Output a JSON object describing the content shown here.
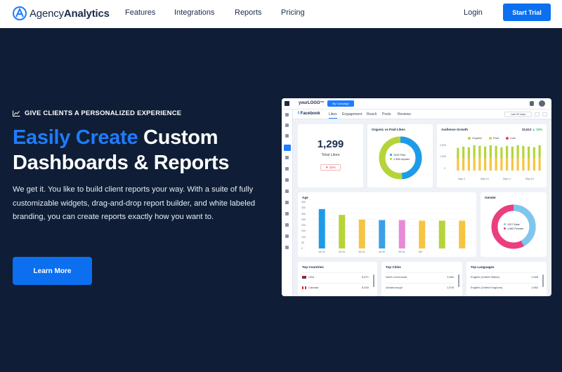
{
  "nav": {
    "brand_light": "Agency",
    "brand_bold": "Analytics",
    "links": [
      "Features",
      "Integrations",
      "Reports",
      "Pricing"
    ],
    "login": "Login",
    "cta": "Start Trial"
  },
  "hero": {
    "eyebrow": "GIVE CLIENTS A PERSONALIZED EXPERIENCE",
    "title_accent": "Easily Create",
    "title_rest_1": "Custom",
    "title_rest_2": "Dashboards & Reports",
    "lead": "We get it. You like to build client reports your way. With a suite of fully customizable widgets, drag-and-drop report builder, and white labeled branding, you can create reports exactly how you want to.",
    "button": "Learn More"
  },
  "colors": {
    "accent": "#1e7cff",
    "button": "#0b6ff0",
    "background": "#0f1e36",
    "paid": "#1e9be8",
    "unpaid": "#b5d43a",
    "organic": "#b5d43a",
    "lost": "#f5c542",
    "male": "#7cc7ef",
    "female": "#ec3d7f"
  },
  "dashboard": {
    "logo": "yourLOGO™",
    "campaign": "My Campaign",
    "date_range": "Last 30 days",
    "platform": "Facebook",
    "tabs": [
      "Likes",
      "Engagement",
      "Reach",
      "Posts",
      "Reviews"
    ],
    "total_likes": {
      "value": "1,299",
      "label": "Total Likes",
      "change": "35%"
    },
    "organic_paid": {
      "title": "Organic vs Paid Likes",
      "paid_label": "1232 Paid",
      "unpaid_label": "1,308 Unpaid",
      "paid": 1232,
      "unpaid": 1308
    },
    "audience": {
      "title": "Audience Growth",
      "total": "22,612",
      "change": "10%",
      "legend": [
        "Organic",
        "Paid",
        "Lost"
      ],
      "xlabels": [
        "May 3",
        "May 10",
        "May 17",
        "May 24"
      ],
      "yticks": [
        "2,000",
        "1,000",
        "0"
      ]
    },
    "age": {
      "title": "Age",
      "yticks": [
        "400",
        "350",
        "300",
        "250",
        "200",
        "150",
        "100",
        "50",
        "0"
      ],
      "categories": [
        "18-24",
        "25-34",
        "35-44",
        "45-54",
        "55-64",
        "65+",
        "",
        ""
      ]
    },
    "gender": {
      "title": "Gender",
      "male_label": "1207 Male",
      "female_label": "1,660 Female",
      "male": 1207,
      "female": 1660
    },
    "countries": {
      "title": "Top Countries",
      "rows": [
        {
          "name": "USA",
          "value": "5,671"
        },
        {
          "name": "Canada",
          "value": "5,540"
        }
      ]
    },
    "cities": {
      "title": "Top Cities",
      "rows": [
        {
          "name": "North Lexxmouth",
          "value": "1,584"
        },
        {
          "name": "Ashaborough",
          "value": "1,578"
        }
      ]
    },
    "languages": {
      "title": "Top Languages",
      "rows": [
        {
          "name": "English (United States)",
          "value": "1,548"
        },
        {
          "name": "English (United Kingdom)",
          "value": "1,582"
        }
      ]
    }
  },
  "chart_data": [
    {
      "type": "bar",
      "title": "Age",
      "categories": [
        "18-24",
        "25-34",
        "35-44",
        "45-54",
        "55-64",
        "65+",
        "",
        ""
      ],
      "values": [
        340,
        290,
        250,
        245,
        245,
        240,
        240,
        240
      ],
      "ylim": [
        0,
        400
      ],
      "colors": [
        "#1e9be8",
        "#b5d43a",
        "#f5c542",
        "#3aa0e8",
        "#e88ad8",
        "#f5c542",
        "#b5d43a",
        "#f5c542"
      ]
    },
    {
      "type": "bar",
      "title": "Audience Growth",
      "series": [
        {
          "name": "Organic",
          "values": [
            1700,
            1800,
            1750,
            1900,
            1850,
            1800,
            1900,
            1850,
            1750,
            1850,
            1800,
            1900,
            1850,
            1800,
            1750,
            1900
          ]
        },
        {
          "name": "Lost",
          "values": [
            900,
            950,
            900,
            1000,
            950,
            900,
            1000,
            950,
            900,
            950,
            900,
            1000,
            950,
            900,
            950,
            1000
          ]
        }
      ],
      "ylim": [
        0,
        2000
      ]
    }
  ]
}
